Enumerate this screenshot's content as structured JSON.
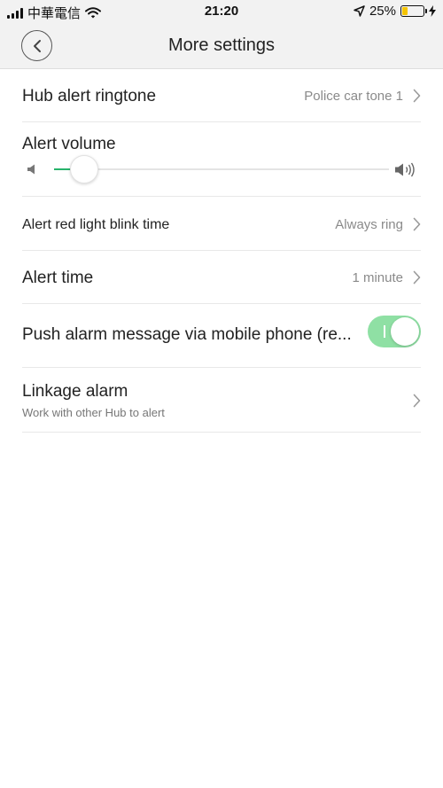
{
  "status_bar": {
    "carrier": "中華電信",
    "time": "21:20",
    "battery_percent": "25%",
    "battery_level": 0.25,
    "icons": [
      "signal-bars-icon",
      "wifi-icon",
      "location-arrow-icon",
      "battery-icon",
      "charging-bolt-icon"
    ]
  },
  "nav": {
    "title": "More settings",
    "back_icon": "chevron-left-icon"
  },
  "settings": {
    "ringtone": {
      "label": "Hub alert ringtone",
      "value": "Police car tone 1"
    },
    "volume": {
      "label": "Alert volume",
      "level": 0.09,
      "min_icon": "speaker-mute-icon",
      "max_icon": "speaker-loud-icon"
    },
    "blink_time": {
      "label": "Alert red light blink time",
      "value": "Always ring"
    },
    "alert_time": {
      "label": "Alert time",
      "value": "1 minute"
    },
    "push_alarm": {
      "label": "Push alarm message via mobile phone (re...",
      "enabled": true
    },
    "linkage": {
      "label": "Linkage alarm",
      "sublabel": "Work with other Hub to alert"
    }
  },
  "colors": {
    "accent_green": "#27b36b",
    "toggle_on": "#8fe0a4",
    "battery_yellow": "#f5c400"
  }
}
